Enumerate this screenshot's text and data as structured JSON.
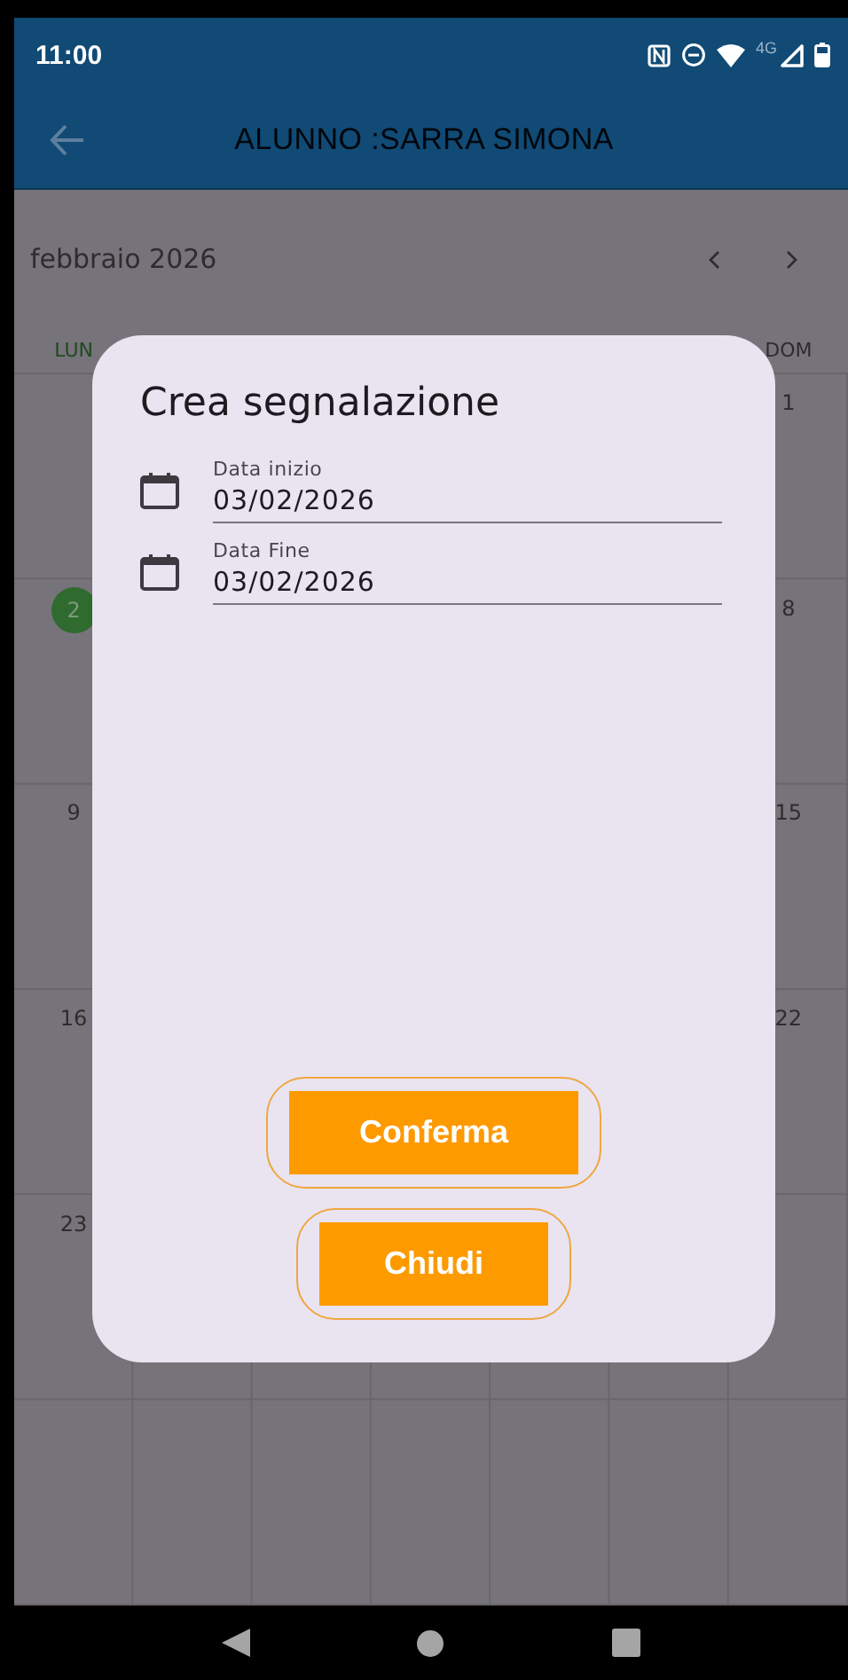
{
  "status_bar": {
    "time": "11:00",
    "network": "4G"
  },
  "app_bar": {
    "title": "ALUNNO :SARRA SIMONA"
  },
  "calendar": {
    "month": "febbraio 2026",
    "weekdays": [
      {
        "label": "LUN",
        "kind": "monday",
        "color": "#1f4a1f"
      },
      {
        "label": "DOM",
        "kind": "sunday",
        "color": "#2e2c30"
      }
    ],
    "weeks": [
      {
        "days": [
          {
            "label": "1",
            "kind": "sunday",
            "selected": false
          }
        ]
      },
      {
        "days": [
          {
            "label": "2",
            "kind": "monday",
            "selected": true
          },
          {
            "label": "8",
            "kind": "sunday",
            "selected": false
          }
        ]
      },
      {
        "days": [
          {
            "label": "9",
            "kind": "monday",
            "selected": false
          },
          {
            "label": "15",
            "kind": "sunday",
            "selected": false
          }
        ]
      },
      {
        "days": [
          {
            "label": "16",
            "kind": "monday",
            "selected": false
          },
          {
            "label": "22",
            "kind": "sunday",
            "selected": false
          }
        ]
      },
      {
        "days": [
          {
            "label": "23",
            "kind": "monday",
            "selected": false
          }
        ]
      }
    ]
  },
  "dialog": {
    "title": "Crea segnalazione",
    "fields": [
      {
        "label": "Data inizio",
        "value": "03/02/2026"
      },
      {
        "label": "Data Fine",
        "value": "03/02/2026"
      }
    ],
    "buttons": [
      {
        "label": "Conferma"
      },
      {
        "label": "Chiudi"
      }
    ]
  }
}
